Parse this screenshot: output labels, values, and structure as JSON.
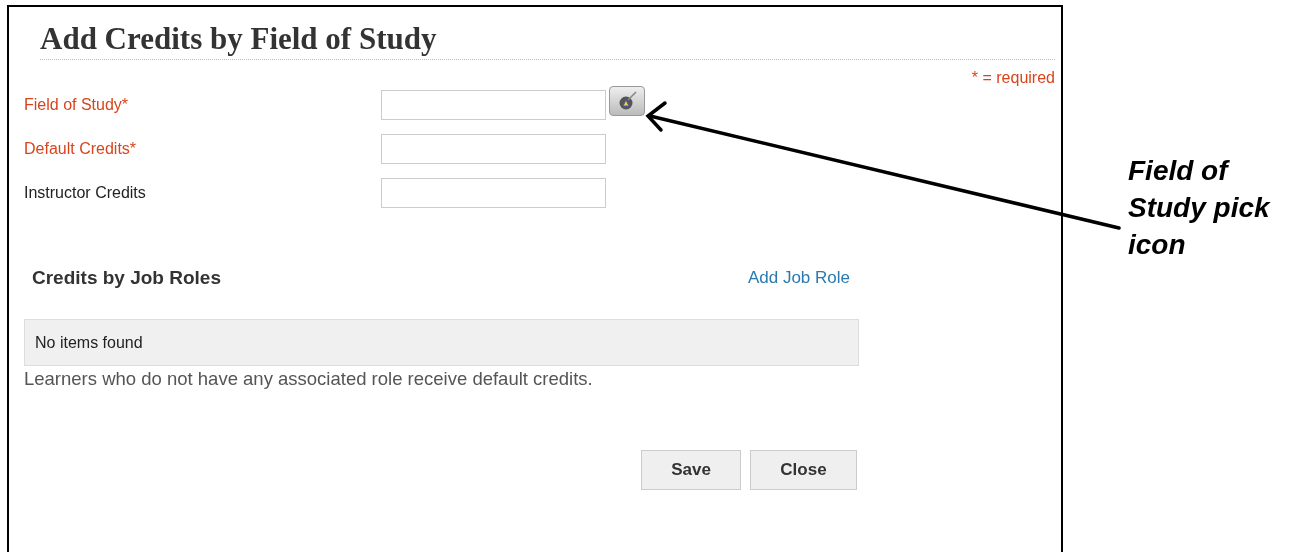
{
  "dialog": {
    "title": "Add Credits by Field of Study",
    "required_note": "* = required",
    "fields": [
      {
        "label": "Field of Study*",
        "required": true,
        "picker": true
      },
      {
        "label": "Default Credits*",
        "required": true,
        "picker": false
      },
      {
        "label": "Instructor Credits",
        "required": false,
        "picker": false
      }
    ],
    "section": {
      "title": "Credits by Job Roles",
      "link": "Add Job Role",
      "empty_text": "No items found",
      "note": "Learners who do not have any associated role receive default credits."
    },
    "buttons": [
      "Save",
      "Close"
    ]
  },
  "callout": {
    "text": "Field of Study pick icon"
  }
}
